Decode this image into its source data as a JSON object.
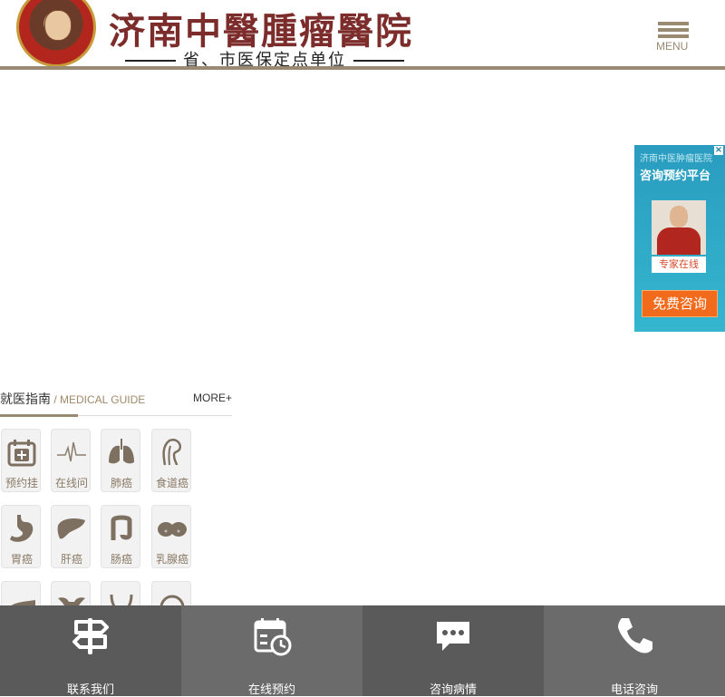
{
  "header": {
    "logo_title": "济南中醫腫瘤醫院",
    "logo_subtitle": "省、市医保定点单位",
    "menu_label": "MENU"
  },
  "consult_widget": {
    "close_label": "×",
    "hospital_name": "济南中医肿瘤医院",
    "platform_title": "咨询预约平台",
    "online_label": "专家在线",
    "free_button": "免费咨询"
  },
  "guide": {
    "title_cn": "就医指南",
    "title_sep": " / ",
    "title_en": "MEDICAL GUIDE",
    "more_label": "MORE+",
    "items": [
      {
        "label": "预约挂号",
        "icon": "calendar-plus-icon"
      },
      {
        "label": "在线问专家",
        "icon": "heartbeat-icon"
      },
      {
        "label": "肺癌",
        "icon": "lungs-icon"
      },
      {
        "label": "食道癌",
        "icon": "esophagus-icon"
      },
      {
        "label": "胃癌",
        "icon": "stomach-icon"
      },
      {
        "label": "肝癌",
        "icon": "liver-icon"
      },
      {
        "label": "肠癌",
        "icon": "intestine-icon"
      },
      {
        "label": "乳腺癌",
        "icon": "breast-icon"
      },
      {
        "label": "",
        "icon": "pancreas-icon"
      },
      {
        "label": "",
        "icon": "uterus-icon"
      },
      {
        "label": "",
        "icon": "bladder-icon"
      },
      {
        "label": "",
        "icon": "organ-icon"
      }
    ]
  },
  "bottom_nav": {
    "items": [
      {
        "label": "联系我们",
        "icon": "signpost-icon"
      },
      {
        "label": "在线预约",
        "icon": "calendar-clock-icon"
      },
      {
        "label": "咨询病情",
        "icon": "chat-bubble-icon"
      },
      {
        "label": "电话咨询",
        "icon": "phone-icon"
      }
    ]
  },
  "colors": {
    "accent": "#9a8a72",
    "brand_red": "#7c2c2a",
    "widget_blue": "#2a9cbf",
    "widget_orange": "#f26b1d",
    "nav_dark": "#5a5a5a",
    "nav_light": "#6b6b6b"
  }
}
